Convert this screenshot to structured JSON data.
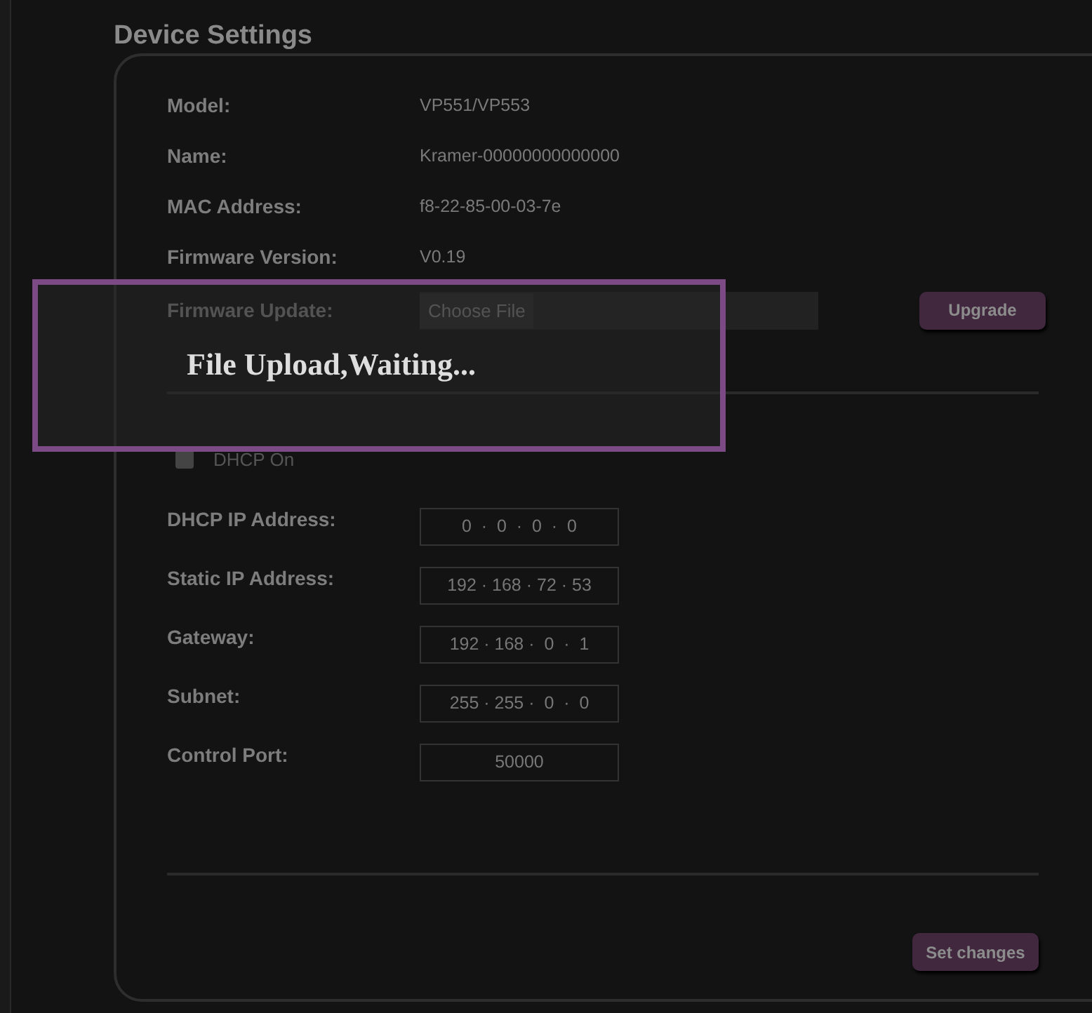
{
  "title": "Device Settings",
  "info": [
    {
      "label": "Model:",
      "value": "VP551/VP553"
    },
    {
      "label": "Name:",
      "value": "Kramer-00000000000000"
    },
    {
      "label": "MAC Address:",
      "value": "f8-22-85-00-03-7e"
    },
    {
      "label": "Firmware Version:",
      "value": "V0.19"
    }
  ],
  "firmware_update": {
    "label": "Firmware Update:",
    "choose_button": "Choose File",
    "upgrade_button": "Upgrade"
  },
  "dhcp": {
    "label": "DHCP On",
    "checked": false
  },
  "network": [
    {
      "label": "DHCP IP Address:",
      "value": "0  ·  0  ·  0  ·  0"
    },
    {
      "label": "Static IP Address:",
      "value": "192 · 168 · 72 · 53"
    },
    {
      "label": "Gateway:",
      "value": "192 · 168 ·  0  ·  1"
    },
    {
      "label": "Subnet:",
      "value": "255 · 255 ·  0  ·  0"
    },
    {
      "label": "Control Port:",
      "value": "50000"
    }
  ],
  "set_button": "Set changes",
  "overlay": {
    "message": "File Upload,Waiting..."
  }
}
